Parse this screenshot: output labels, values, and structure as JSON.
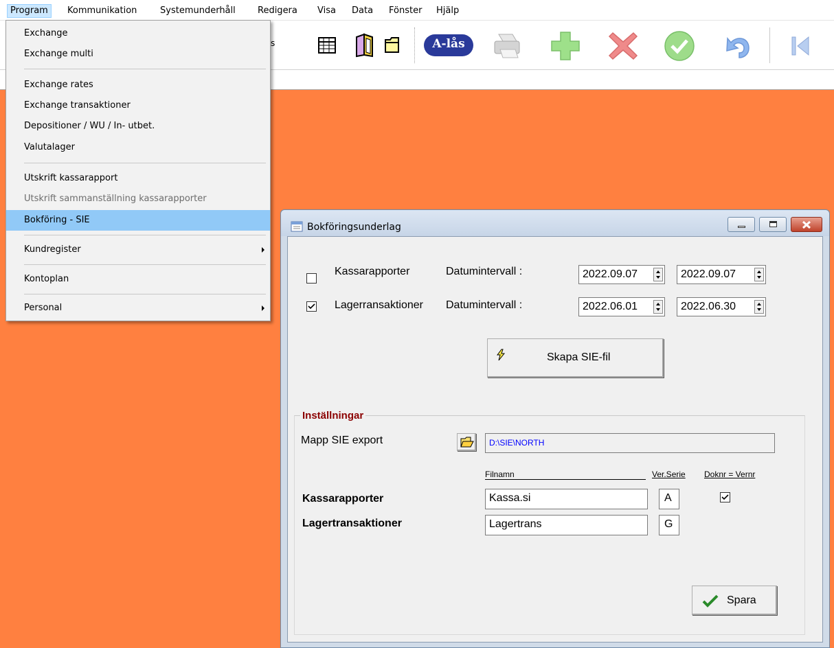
{
  "menubar": {
    "items": [
      "Program",
      "Kommunikation",
      "Systemunderhåll",
      "Redigera",
      "Visa",
      "Data",
      "Fönster",
      "Hjälp"
    ]
  },
  "toolbar": {
    "truncated_label": "s",
    "alas_label": "A-lås"
  },
  "program_menu": {
    "items": [
      "Exchange",
      "Exchange multi",
      "Exchange rates",
      "Exchange transaktioner",
      "Depositioner / WU / In- utbet.",
      "Valutalager",
      "Utskrift kassarapport",
      "Utskrift sammanställning kassarapporter",
      "Bokföring - SIE",
      "Kundregister",
      "Kontoplan",
      "Personal"
    ]
  },
  "dialog": {
    "title": "Bokföringsunderlag",
    "rows": [
      {
        "checked": false,
        "label": "Kassarapporter",
        "range_label": "Datumintervall :",
        "from": "2022.09.07",
        "to": "2022.09.07"
      },
      {
        "checked": true,
        "label": "Lagerransaktioner",
        "range_label": "Datumintervall :",
        "from": "2022.06.01",
        "to": "2022.06.30"
      }
    ],
    "create_button": "Skapa SIE-fil",
    "settings": {
      "title": "Inställningar",
      "folder_label": "Mapp SIE export",
      "folder_value": "D:\\SIE\\NORTH",
      "col_filename": "Filnamn",
      "col_series": "Ver.Serie",
      "col_doknr": "Doknr = Vernr",
      "kassa_label": "Kassarapporter",
      "kassa_file": "Kassa.si",
      "kassa_series": "A",
      "kassa_doknr_checked": true,
      "lager_label": "Lagertransaktioner",
      "lager_file": "Lagertrans",
      "lager_series": "G"
    },
    "save_button": "Spara"
  },
  "colors": {
    "background": "#ff8040",
    "menu_highlight": "#91c9f7",
    "folder_text": "#0000ff",
    "group_title": "#8b0000"
  }
}
